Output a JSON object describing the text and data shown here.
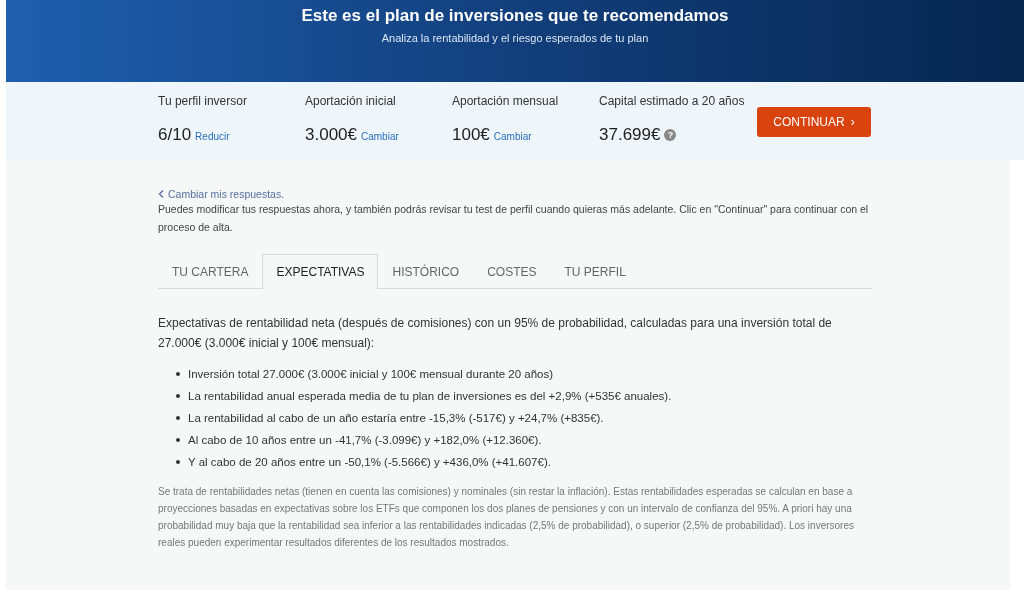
{
  "header": {
    "title": "Este es el plan de inversiones que te recomendamos",
    "subtitle": "Analiza la rentabilidad y el riesgo esperados de tu plan"
  },
  "summary": [
    {
      "label": "Tu perfil inversor",
      "value": "6/10",
      "link": "Reducir"
    },
    {
      "label": "Aportación inicial",
      "value": "3.000€",
      "link": "Cambiar"
    },
    {
      "label": "Aportación mensual",
      "value": "100€",
      "link": "Cambiar"
    },
    {
      "label": "Capital estimado a 20 años",
      "value": "37.699€",
      "help": "?"
    }
  ],
  "continue_button": {
    "label": "CONTINUAR",
    "caret": "›"
  },
  "back_link": "Cambiar mis respuestas.",
  "intro": "Puedes modificar tus respuestas ahora, y también podrás revisar tu test de perfil cuando quieras más adelante. Clic en \"Continuar\" para continuar con el proceso de alta.",
  "tabs": [
    {
      "label": "TU CARTERA",
      "selected": false
    },
    {
      "label": "EXPECTATIVAS",
      "selected": true
    },
    {
      "label": "HISTÓRICO",
      "selected": false
    },
    {
      "label": "COSTES",
      "selected": false
    },
    {
      "label": "TU PERFIL",
      "selected": false
    }
  ],
  "lead": "Expectativas de rentabilidad neta (después de comisiones) con un 95% de probabilidad, calculadas para una inversión total de 27.000€ (3.000€ inicial y 100€ mensual):",
  "bullets": [
    "Inversión total 27.000€ (3.000€ inicial y 100€ mensual durante 20 años)",
    "La rentabilidad anual esperada media de tu plan de inversiones es del +2,9% (+535€ anuales).",
    "La rentabilidad al cabo de un año estaría entre -15,3% (-517€) y +24,7% (+835€).",
    "Al cabo de 10 años entre un -41,7% (-3.099€) y +182,0% (+12.360€).",
    "Y al cabo de 20 años entre un -50,1% (-5.566€) y +436,0% (+41.607€)."
  ],
  "footnote": "Se trata de rentabilidades netas (tienen en cuenta las comisiones) y nominales (sin restar la inflación). Estas rentabilidades esperadas se calculan en base a proyecciones basadas en expectativas sobre los ETFs que componen los dos planes de pensiones y con un intervalo de confianza del 95%. A priori hay una probabilidad muy baja que la rentabilidad sea inferior a las rentabilidades indicadas (2,5% de probabilidad), o superior (2,5% de probabilidad). Los inversores reales pueden experimentar resultados diferentes de los resultados mostrados."
}
